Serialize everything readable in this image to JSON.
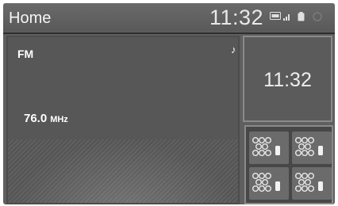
{
  "header": {
    "title": "Home",
    "clock": "11:32",
    "status_icons": [
      "bluetooth-icon",
      "signal-bars-icon",
      "phone-battery-icon",
      "power-icon"
    ]
  },
  "audio": {
    "source": "FM",
    "frequency": "76.0",
    "unit": "MHz",
    "icon": "music-note-icon"
  },
  "clock_widget": {
    "time": "11:32"
  },
  "presets": {
    "tiles": [
      "preset-1",
      "preset-2",
      "preset-3",
      "preset-4"
    ],
    "icon": "preset-dots-icon"
  },
  "colors": {
    "screen": "#5f5f5f",
    "panel": "#575757",
    "text": "#ffffff",
    "border": "#8a8a8a"
  }
}
